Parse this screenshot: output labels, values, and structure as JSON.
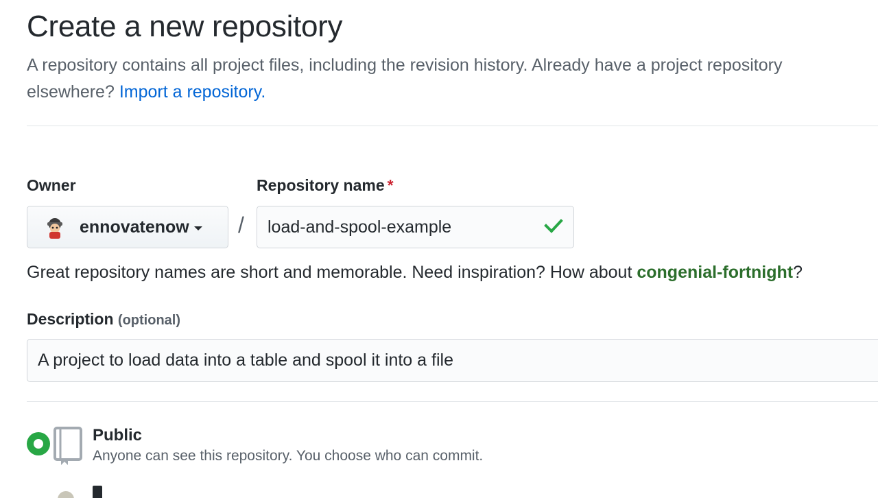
{
  "page": {
    "title": "Create a new repository",
    "intro_text": "A repository contains all project files, including the revision history. Already have a project repository elsewhere?",
    "import_link": "Import a repository."
  },
  "owner": {
    "label": "Owner",
    "name": "ennovatenow"
  },
  "repo": {
    "label": "Repository name",
    "required_mark": "*",
    "value": "load-and-spool-example",
    "separator": "/"
  },
  "hint": {
    "text": "Great repository names are short and memorable. Need inspiration? How about",
    "suggestion": "congenial-fortnight",
    "suffix": "?"
  },
  "description": {
    "label": "Description",
    "optional": "(optional)",
    "value": "A project to load data into a table and spool it into a file"
  },
  "visibility": {
    "public_title": "Public",
    "public_desc": "Anyone can see this repository. You choose who can commit.",
    "selected": "public"
  },
  "colors": {
    "accent_green": "#28a745",
    "link_blue": "#0366d6",
    "required_red": "#cb2431",
    "suggestion_green": "#2c6e2c"
  }
}
